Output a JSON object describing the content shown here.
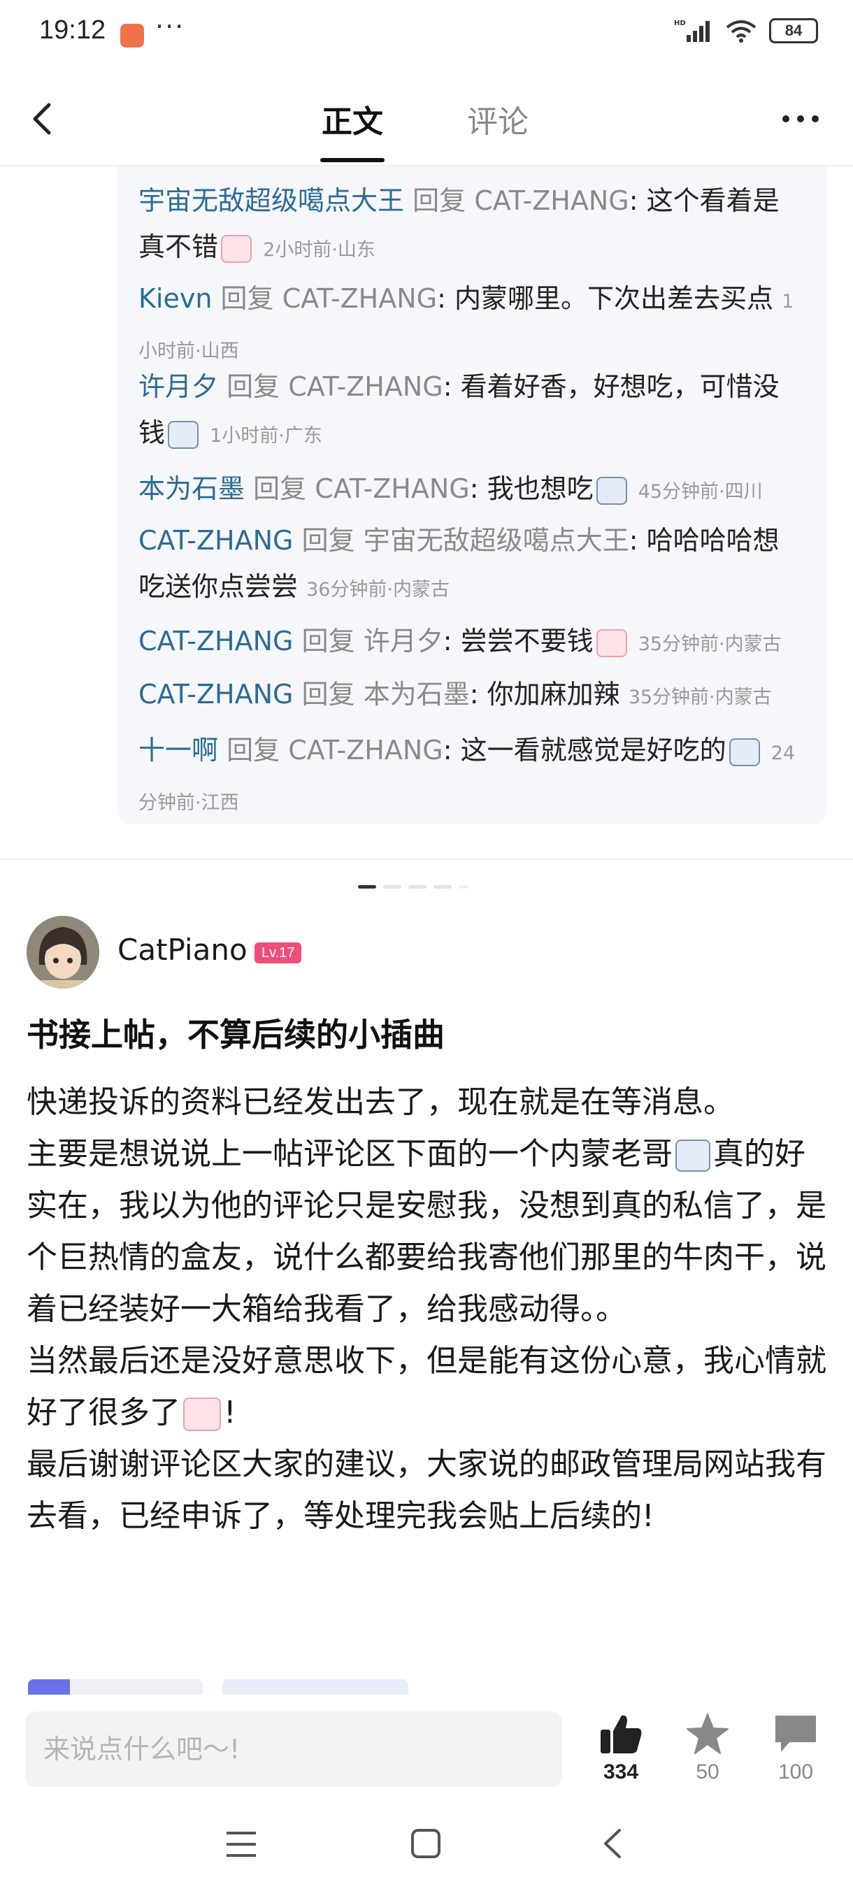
{
  "status_bar": {
    "time": "19:12",
    "more": "···",
    "battery": "84"
  },
  "nav": {
    "tab_main": "正文",
    "tab_comments": "评论"
  },
  "replies": [
    {
      "user": "宇宙无敌超级噶点大王",
      "reply_word": "回复",
      "target": "CAT-ZHANG",
      "text": ": 这个看着是真不错",
      "meta": "2小时前·山东"
    },
    {
      "user": "Kievn",
      "reply_word": "回复",
      "target": "CAT-ZHANG",
      "text": ": 内蒙哪里。下次出差去买点",
      "meta": "1小时前·山西"
    },
    {
      "user": "许月夕",
      "reply_word": "回复",
      "target": "CAT-ZHANG",
      "text": ": 看着好香，好想吃，可惜没钱",
      "meta": "1小时前·广东"
    },
    {
      "user": "本为石墨",
      "reply_word": "回复",
      "target": "CAT-ZHANG",
      "text": ": 我也想吃",
      "meta": "45分钟前·四川"
    },
    {
      "user": "CAT-ZHANG",
      "reply_word": "回复",
      "target": "宇宙无敌超级噶点大王",
      "text": ": 哈哈哈哈想吃送你点尝尝",
      "meta": "36分钟前·内蒙古"
    },
    {
      "user": "CAT-ZHANG",
      "reply_word": "回复",
      "target": "许月夕",
      "text": ": 尝尝不要钱",
      "meta": "35分钟前·内蒙古"
    },
    {
      "user": "CAT-ZHANG",
      "reply_word": "回复",
      "target": "本为石墨",
      "text": ": 你加麻加辣",
      "meta": "35分钟前·内蒙古"
    },
    {
      "user": "十一啊",
      "reply_word": "回复",
      "target": "CAT-ZHANG",
      "text": ": 这一看就感觉是好吃的",
      "meta": "24分钟前·江西"
    }
  ],
  "post": {
    "author": "CatPiano",
    "level": "Lv.17",
    "title": "书接上帖，不算后续的小插曲",
    "p1": "快递投诉的资料已经发出去了，现在就是在等消息。",
    "p2a": "主要是想说说上一帖评论区下面的一个内蒙老哥",
    "p2b": "真的好实在，我以为他的评论只是安慰我，没想到真的私信了，是个巨热情的盒友，说什么都要给我寄他们那里的牛肉干，说着已经装好一大箱给我看了，给我感动得。。",
    "p3a": "当然最后还是没好意思收下，但是能有这份心意，我心情就好了很多了",
    "p3b": "!",
    "p4": "最后谢谢评论区大家的建议，大家说的邮政管理局网站我有去看，已经申诉了，等处理完我会贴上后续的!"
  },
  "bottom_bar": {
    "input_placeholder": "来说点什么吧～!",
    "likes": "334",
    "favorites": "50",
    "comments": "100"
  }
}
